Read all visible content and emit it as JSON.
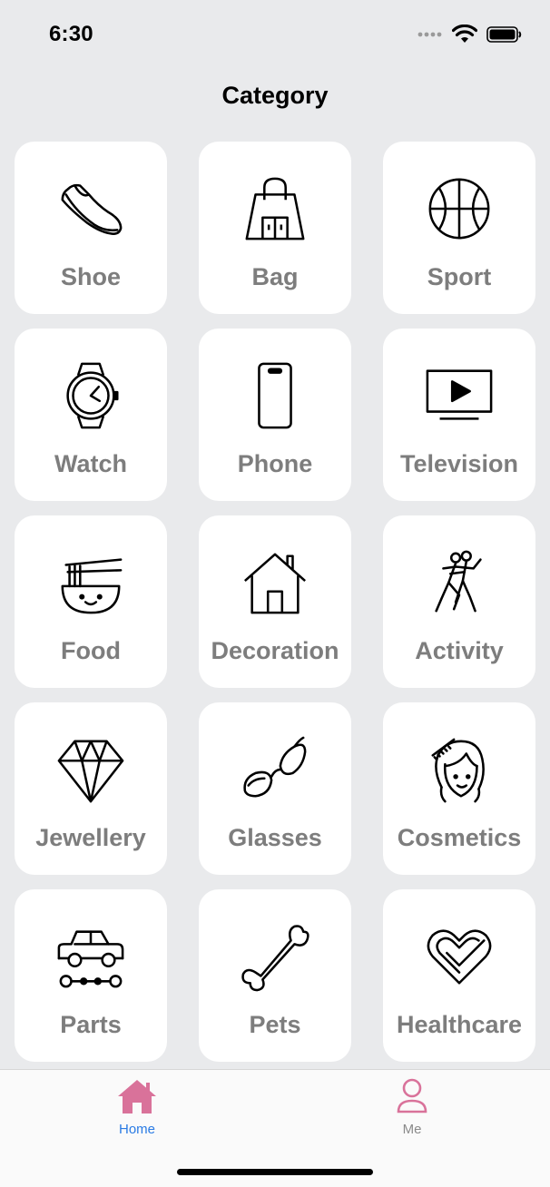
{
  "status_bar": {
    "time": "6:30",
    "icons": [
      "signal-dots-icon",
      "wifi-icon",
      "battery-icon"
    ]
  },
  "header": {
    "title": "Category"
  },
  "categories": [
    {
      "label": "Shoe",
      "icon": "shoe-icon"
    },
    {
      "label": "Bag",
      "icon": "bag-icon"
    },
    {
      "label": "Sport",
      "icon": "basketball-icon"
    },
    {
      "label": "Watch",
      "icon": "watch-icon"
    },
    {
      "label": "Phone",
      "icon": "phone-icon"
    },
    {
      "label": "Television",
      "icon": "television-icon"
    },
    {
      "label": "Food",
      "icon": "noodle-bowl-icon"
    },
    {
      "label": "Decoration",
      "icon": "house-icon"
    },
    {
      "label": "Activity",
      "icon": "dancing-icon"
    },
    {
      "label": "Jewellery",
      "icon": "diamond-icon"
    },
    {
      "label": "Glasses",
      "icon": "glasses-icon"
    },
    {
      "label": "Cosmetics",
      "icon": "hair-comb-icon"
    },
    {
      "label": "Parts",
      "icon": "car-parts-icon"
    },
    {
      "label": "Pets",
      "icon": "bone-icon"
    },
    {
      "label": "Healthcare",
      "icon": "heart-check-icon"
    }
  ],
  "tab_bar": {
    "tabs": [
      {
        "label": "Home",
        "icon": "home-icon",
        "active": true
      },
      {
        "label": "Me",
        "icon": "person-icon",
        "active": false
      }
    ],
    "accent_color": "#d9729a",
    "active_label_color": "#2a7be4"
  }
}
